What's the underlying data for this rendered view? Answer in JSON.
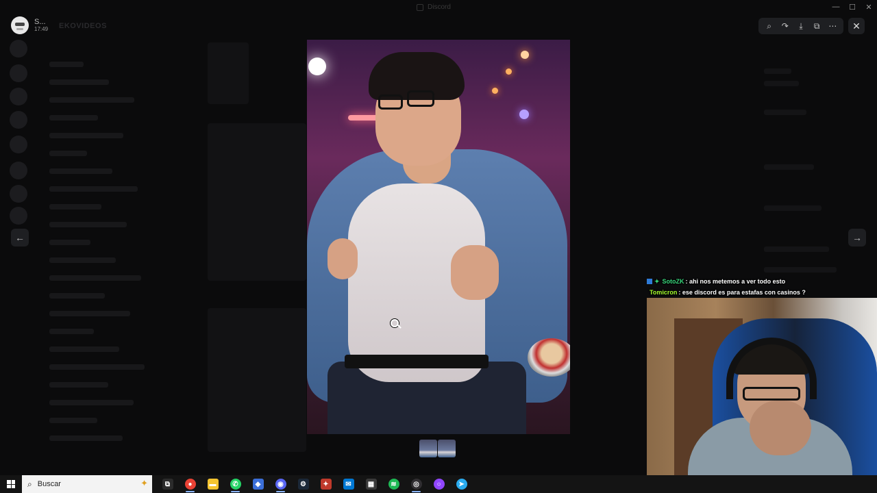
{
  "viewer": {
    "user_name": "S...",
    "timestamp": "17:49",
    "window_title": "Discord",
    "tools": [
      {
        "icon": "zoom-icon",
        "glyph": "⌕"
      },
      {
        "icon": "forward-icon",
        "glyph": "↷"
      },
      {
        "icon": "download-icon",
        "glyph": "⤓"
      },
      {
        "icon": "open-external-icon",
        "glyph": "⧉"
      },
      {
        "icon": "more-icon",
        "glyph": "⋯"
      }
    ],
    "close_glyph": "✕",
    "prev_glyph": "←",
    "next_glyph": "→",
    "thumbnails": 2
  },
  "background": {
    "server_label": "EKOVIDEOS"
  },
  "stream_chat": [
    {
      "user": "SotoZK",
      "user_color": "#37d67a",
      "text": " : ahi nos metemos a ver todo esto",
      "badges": true
    },
    {
      "user": "Tomicron",
      "user_color": "#a6ff2e",
      "text": " : ese discord es para estafas con casinos ?",
      "badges": false
    }
  ],
  "window_controls": {
    "minimize": "—",
    "maximize": "☐",
    "close": "✕"
  },
  "taskbar": {
    "search_placeholder": "Buscar",
    "apps": [
      {
        "name": "task-view-icon",
        "color": "#2b2b2b",
        "glyph": "⧉",
        "active": false
      },
      {
        "name": "chrome-icon",
        "color": "#e94235",
        "glyph": "●",
        "active": true
      },
      {
        "name": "file-explorer-icon",
        "color": "#f4c430",
        "glyph": "▬",
        "active": false
      },
      {
        "name": "whatsapp-icon",
        "color": "#25d366",
        "glyph": "✆",
        "active": true
      },
      {
        "name": "app-blue-icon",
        "color": "#3b6fd9",
        "glyph": "◆",
        "active": false
      },
      {
        "name": "discord-icon",
        "color": "#5865f2",
        "glyph": "◉",
        "active": true
      },
      {
        "name": "steam-icon",
        "color": "#1b2838",
        "glyph": "⚙",
        "active": false
      },
      {
        "name": "app-game-icon",
        "color": "#c0392b",
        "glyph": "✦",
        "active": false
      },
      {
        "name": "mail-icon",
        "color": "#0078d4",
        "glyph": "✉",
        "active": false
      },
      {
        "name": "calculator-icon",
        "color": "#3a3a3a",
        "glyph": "▦",
        "active": false
      },
      {
        "name": "spotify-icon",
        "color": "#1db954",
        "glyph": "≋",
        "active": false
      },
      {
        "name": "obs-icon",
        "color": "#302e31",
        "glyph": "◎",
        "active": true
      },
      {
        "name": "twitch-icon",
        "color": "#9146ff",
        "glyph": "○",
        "active": false
      },
      {
        "name": "telegram-icon",
        "color": "#2aabee",
        "glyph": "➤",
        "active": false
      }
    ]
  }
}
